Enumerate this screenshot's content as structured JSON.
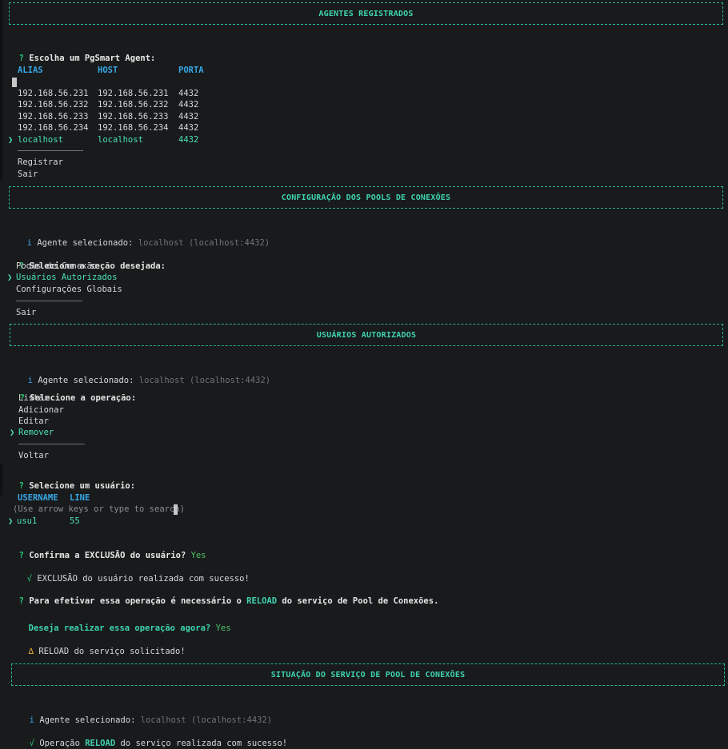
{
  "banners": {
    "agents": "AGENTES REGISTRADOS",
    "pools_config": "CONFIGURAÇÃO DOS POOLS DE CONEXÕES",
    "users": "USUÁRIOS AUTORIZADOS",
    "status": "SITUAÇÃO DO SERVIÇO DE POOL DE CONEXÕES"
  },
  "agent_prompt": {
    "mark": "?",
    "text": "Escolha um PgSmart Agent:",
    "headers": [
      "ALIAS",
      "HOST",
      "PORTA"
    ],
    "rows": [
      {
        "alias": "192.168.56.231",
        "host": "192.168.56.231",
        "port": "4432"
      },
      {
        "alias": "192.168.56.232",
        "host": "192.168.56.232",
        "port": "4432"
      },
      {
        "alias": "192.168.56.233",
        "host": "192.168.56.233",
        "port": "4432"
      },
      {
        "alias": "192.168.56.234",
        "host": "192.168.56.234",
        "port": "4432"
      },
      {
        "alias": "localhost",
        "host": "localhost",
        "port": "4432"
      }
    ],
    "pointer": "❯",
    "actions": [
      "Registrar",
      "Sair"
    ]
  },
  "pools": {
    "info_mark": "i",
    "info_label": "Agente selecionado:",
    "info_value": "localhost (localhost:4432)",
    "prompt_mark": "?",
    "prompt": "Selecione a seção desejada:",
    "options": [
      "Pools de Conexão",
      "Usuários Autorizados",
      "Configurações Globais"
    ],
    "exit": "Sair"
  },
  "users": {
    "info_mark": "i",
    "info_label": "Agente selecionado:",
    "info_value": "localhost (localhost:4432)",
    "op_mark": "?",
    "op_prompt": "Selecione a operação:",
    "ops": [
      "Listar",
      "Adicionar",
      "Editar",
      "Remover"
    ],
    "back": "Voltar",
    "user_mark": "?",
    "user_prompt": "Selecione um usuário:",
    "headers": [
      "USERNAME",
      "LINE"
    ],
    "hint": "(Use arrow keys or type to search)",
    "user_row": {
      "name": "usu1",
      "line": "55"
    },
    "confirm_mark": "?",
    "confirm_text": "Confirma a EXCLUSÃO do usuário?",
    "confirm_answer": "Yes",
    "success_mark": "√",
    "success_text": "EXCLUSÃO do usuário realizada com sucesso!",
    "reload_mark": "?",
    "reload_pre": "Para efetivar essa operação é necessário o",
    "reload_word": "RELOAD",
    "reload_post": "do serviço de Pool de Conexões.",
    "now_text": "Deseja realizar essa operação agora?",
    "now_answer": "Yes",
    "warn_mark": "∆",
    "warn_text": "RELOAD do serviço solicitado!"
  },
  "status": {
    "info_mark": "i",
    "info_label": "Agente selecionado:",
    "info_value": "localhost (localhost:4432)",
    "ok_mark": "√",
    "ok_pre": "Operação",
    "ok_word": "RELOAD",
    "ok_post": "do serviço realizada com sucesso!"
  }
}
